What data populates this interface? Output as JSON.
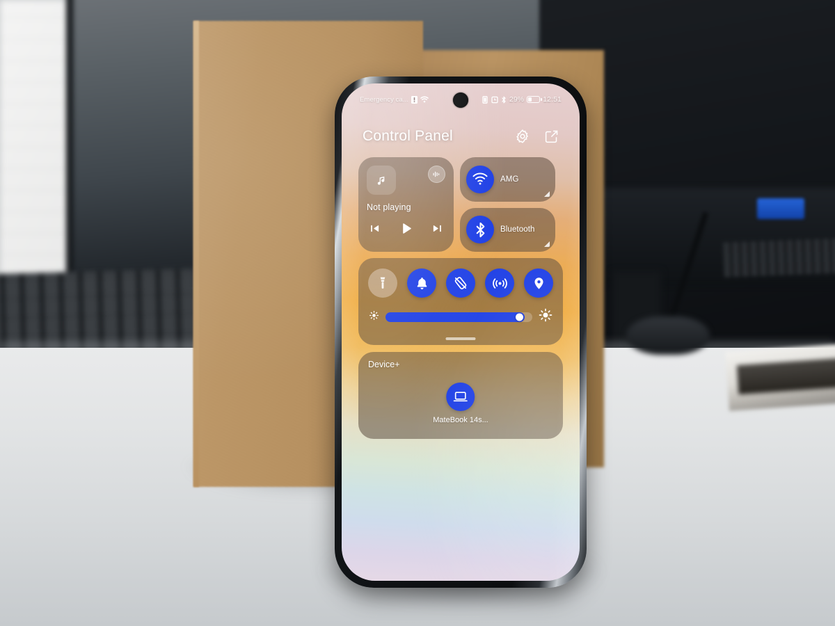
{
  "scene": {
    "description": "smartphone standing on white desk in front of cardboard box and blurred monitors"
  },
  "phone": {
    "status_bar": {
      "carrier": "Emergency ca...",
      "left_icons": [
        "sim-alert-icon",
        "wifi-icon"
      ],
      "right_icons": [
        "vibrate-icon",
        "alarm-icon",
        "bluetooth-icon"
      ],
      "battery_percent": "29%",
      "battery_icon": "battery-icon",
      "time": "12:51"
    },
    "header": {
      "title": "Control Panel",
      "settings_icon": "gear-icon",
      "edit_icon": "edit-square-icon"
    },
    "media_card": {
      "album_icon": "music-note-icon",
      "cast_icon": "audio-output-icon",
      "status": "Not playing",
      "prev_icon": "skip-previous-icon",
      "play_icon": "play-icon",
      "next_icon": "skip-next-icon"
    },
    "connectivity_tiles": [
      {
        "name": "wifi",
        "icon": "wifi-icon",
        "label": "AMG",
        "active": true,
        "expand_icon": "expand-corner-icon"
      },
      {
        "name": "bluetooth",
        "icon": "bluetooth-icon",
        "label": "Bluetooth",
        "active": true,
        "expand_icon": "expand-corner-icon"
      }
    ],
    "quick_toggles": [
      {
        "name": "flashlight",
        "icon": "flashlight-icon",
        "active": false
      },
      {
        "name": "ringer",
        "icon": "bell-icon",
        "active": true
      },
      {
        "name": "rotation-lock",
        "icon": "rotation-lock-icon",
        "active": true
      },
      {
        "name": "hotspot",
        "icon": "hotspot-icon",
        "active": true
      },
      {
        "name": "location",
        "icon": "location-pin-icon",
        "active": true
      }
    ],
    "brightness": {
      "low_icon": "brightness-low-icon",
      "high_icon": "brightness-high-icon",
      "value_percent": 95
    },
    "drag_handle": "panel-drag-handle",
    "device_card": {
      "title": "Device+",
      "devices": [
        {
          "name": "MateBook 14s...",
          "icon": "laptop-icon",
          "active": true
        }
      ]
    }
  },
  "colors": {
    "accent_blue": "#1e3fe6",
    "card_bg": "rgba(86,70,57,.52)",
    "text_white": "#ffffff"
  }
}
